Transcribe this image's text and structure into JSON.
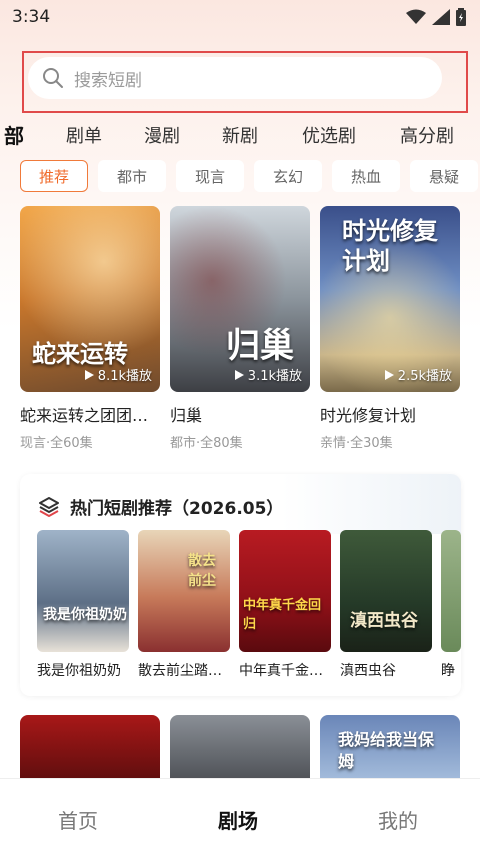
{
  "status": {
    "time": "3:34",
    "icons": [
      "wifi-icon",
      "signal-icon",
      "battery-icon"
    ]
  },
  "search": {
    "placeholder": "搜索短剧"
  },
  "nav_tabs": [
    "部",
    "剧单",
    "漫剧",
    "新剧",
    "优选剧",
    "高分剧"
  ],
  "chips": [
    "推荐",
    "都市",
    "现言",
    "玄幻",
    "热血",
    "悬疑"
  ],
  "featured": [
    {
      "title": "蛇来运转之团团…",
      "meta": "现言·全60集",
      "plays": "8.1k播放",
      "poster_text": "蛇来运转"
    },
    {
      "title": "归巢",
      "meta": "都市·全80集",
      "plays": "3.1k播放",
      "poster_text": "归巢"
    },
    {
      "title": "时光修复计划",
      "meta": "亲情·全30集",
      "plays": "2.5k播放",
      "poster_text": "时光修复计划"
    }
  ],
  "hot": {
    "title": "热门短剧推荐（2026.05）",
    "items": [
      {
        "title": "我是你祖奶奶",
        "poster_text": "我是你祖奶奶"
      },
      {
        "title": "散去前尘踏…",
        "poster_text": "散去前尘"
      },
      {
        "title": "中年真千金…",
        "poster_text": "中年真千金回归"
      },
      {
        "title": "滇西虫谷",
        "poster_text": "滇西虫谷"
      },
      {
        "title": "睁"
      }
    ]
  },
  "bottom_posters": [
    "",
    "",
    "我妈给我当保姆"
  ],
  "bottom_nav": [
    "首页",
    "剧场",
    "我的"
  ],
  "colors": {
    "accent": "#f06a2a",
    "search_highlight": "#e04a4a"
  }
}
